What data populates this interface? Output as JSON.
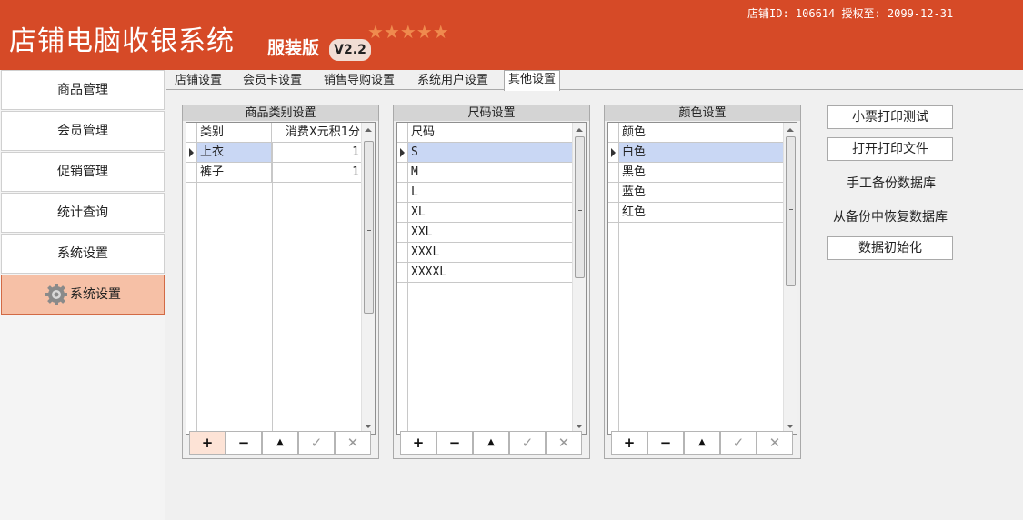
{
  "header": {
    "title": "店铺电脑收银系统",
    "edition": "服装版",
    "version": "V2.2",
    "stars": "★★★★★",
    "shop_info": "店铺ID: 106614 授权至: 2099-12-31"
  },
  "sidebar": {
    "items": [
      {
        "label": "商品管理"
      },
      {
        "label": "会员管理"
      },
      {
        "label": "促销管理"
      },
      {
        "label": "统计查询"
      },
      {
        "label": "系统设置"
      },
      {
        "label": "系统设置",
        "active": true
      }
    ]
  },
  "tabs": [
    {
      "label": "店铺设置"
    },
    {
      "label": "会员卡设置"
    },
    {
      "label": "销售导购设置"
    },
    {
      "label": "系统用户设置"
    },
    {
      "label": "其他设置",
      "active": true
    }
  ],
  "category_panel": {
    "title": "商品类别设置",
    "columns": [
      "类别",
      "消费X元积1分"
    ],
    "rows": [
      {
        "name": "上衣",
        "value": "1"
      },
      {
        "name": "裤子",
        "value": "1"
      }
    ]
  },
  "size_panel": {
    "title": "尺码设置",
    "columns": [
      "尺码"
    ],
    "rows": [
      "S",
      "M",
      "L",
      "XL",
      "XXL",
      "XXXL",
      "XXXXL"
    ]
  },
  "color_panel": {
    "title": "颜色设置",
    "columns": [
      "颜色"
    ],
    "rows": [
      "白色",
      "黑色",
      "蓝色",
      "红色"
    ]
  },
  "toolbar": {
    "add": "+",
    "remove": "−",
    "up": "▲",
    "confirm": "✓",
    "cancel": "✕"
  },
  "actions": {
    "print_test": "小票打印测试",
    "open_print_file": "打开打印文件",
    "manual_backup": "手工备份数据库",
    "restore_backup": "从备份中恢复数据库",
    "data_init": "数据初始化"
  },
  "colors": {
    "header_bg": "#d64a27",
    "active_nav": "#f6c0a6",
    "selected_row": "#c9d7f4"
  }
}
